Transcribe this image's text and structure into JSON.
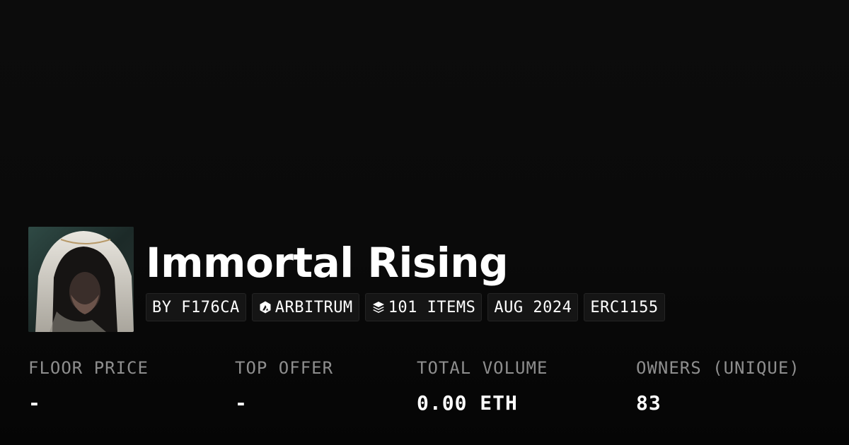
{
  "collection": {
    "name": "Immortal Rising",
    "avatar_icon": "hooded-figure-avatar"
  },
  "chips": [
    {
      "label": "BY F176CA",
      "icon": ""
    },
    {
      "label": "ARBITRUM",
      "icon": "arbitrum-icon"
    },
    {
      "label": "101 ITEMS",
      "icon": "layers-icon"
    },
    {
      "label": "AUG 2024",
      "icon": ""
    },
    {
      "label": "ERC1155",
      "icon": ""
    }
  ],
  "stats": [
    {
      "label": "FLOOR PRICE",
      "value": "-"
    },
    {
      "label": "TOP OFFER",
      "value": "-"
    },
    {
      "label": "TOTAL VOLUME",
      "value": "0.00 ETH"
    },
    {
      "label": "OWNERS (UNIQUE)",
      "value": "83"
    }
  ],
  "colors": {
    "background": "#0b0b0b",
    "chip_background": "#151515",
    "label_gray": "#8e8e8e",
    "text": "#ffffff"
  }
}
